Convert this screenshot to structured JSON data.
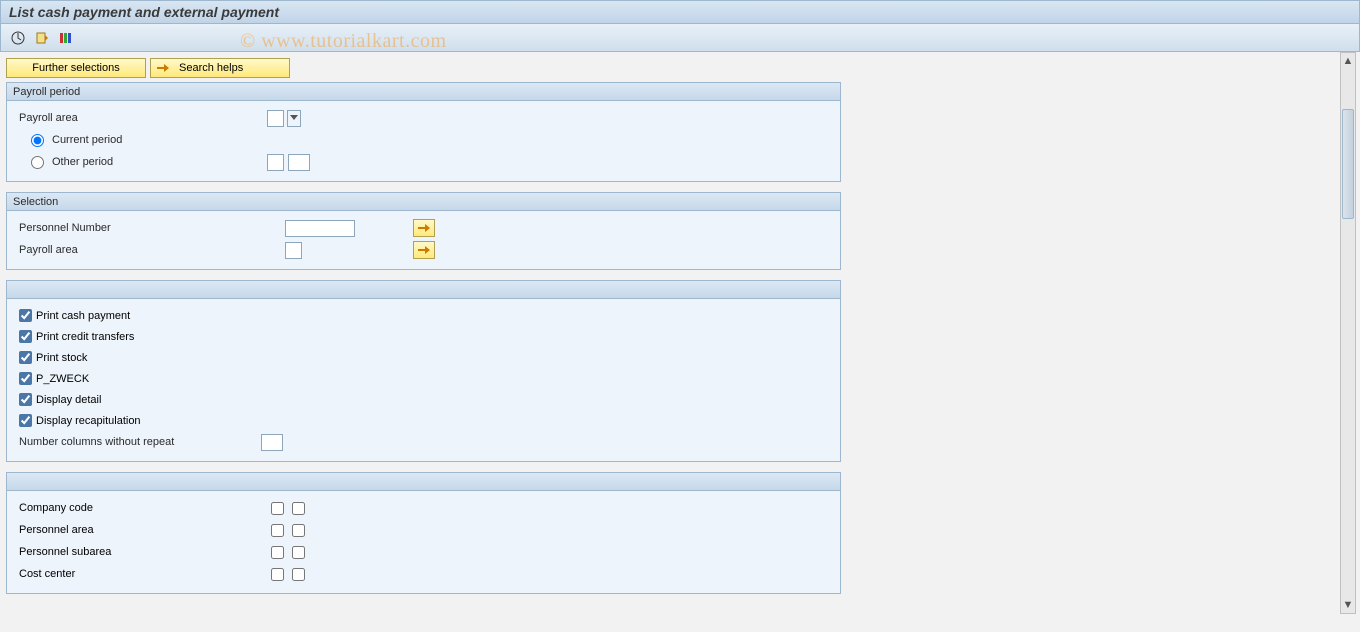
{
  "title": "List cash payment and external payment",
  "watermark": "© www.tutorialkart.com",
  "toolbar_icons": [
    "execute",
    "variant",
    "columns"
  ],
  "buttons": {
    "further_selections": "Further selections",
    "search_helps": "Search helps"
  },
  "groups": {
    "payroll_period": {
      "title": "Payroll period",
      "fields": {
        "payroll_area_label": "Payroll area",
        "payroll_area_value": "",
        "current_period_label": "Current period",
        "current_period_checked": true,
        "other_period_label": "Other period",
        "other_period_checked": false,
        "other_from": "",
        "other_to": ""
      }
    },
    "selection": {
      "title": "Selection",
      "fields": {
        "personnel_number_label": "Personnel Number",
        "personnel_number_value": "",
        "payroll_area_label": "Payroll area",
        "payroll_area_value": ""
      }
    },
    "options": {
      "items": [
        {
          "label": "Print cash payment",
          "checked": true
        },
        {
          "label": "Print credit transfers",
          "checked": true
        },
        {
          "label": "Print stock",
          "checked": true
        },
        {
          "label": "P_ZWECK",
          "checked": true
        },
        {
          "label": "Display detail",
          "checked": true
        },
        {
          "label": "Display recapitulation",
          "checked": true
        }
      ],
      "number_columns_label": "Number columns without repeat",
      "number_columns_value": ""
    },
    "sort": {
      "items": [
        {
          "label": "Company code",
          "c1": false,
          "c2": false
        },
        {
          "label": "Personnel area",
          "c1": false,
          "c2": false
        },
        {
          "label": "Personnel subarea",
          "c1": false,
          "c2": false
        },
        {
          "label": "Cost center",
          "c1": false,
          "c2": false
        }
      ]
    }
  }
}
